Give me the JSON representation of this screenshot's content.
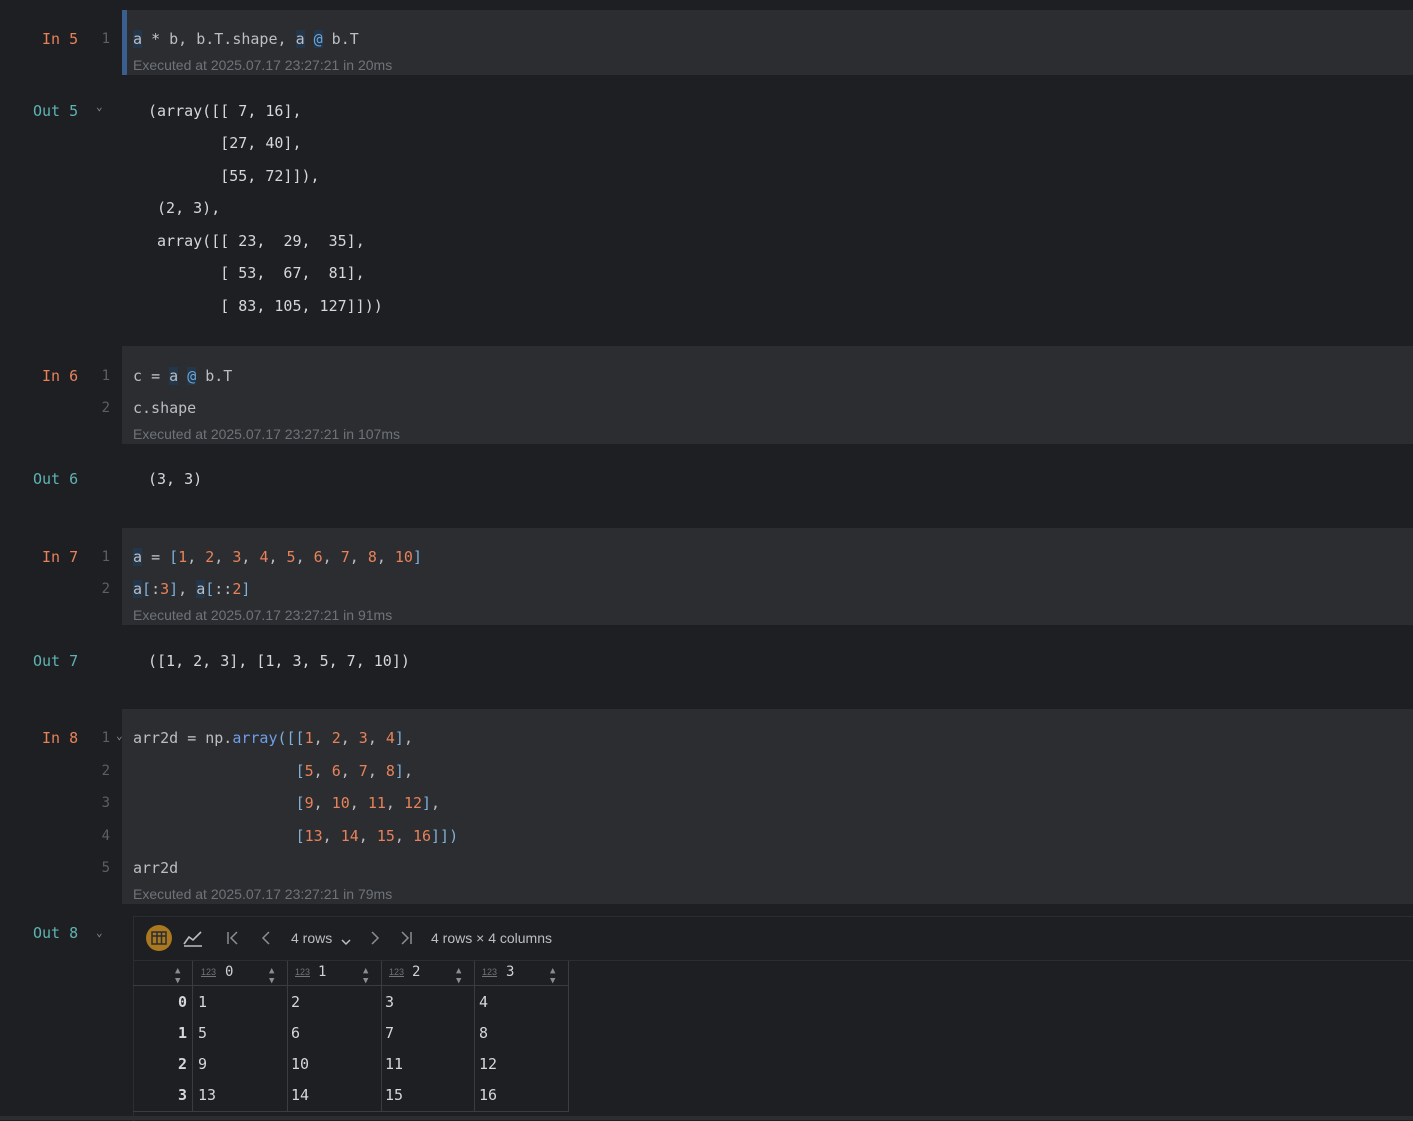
{
  "cells": {
    "in5": {
      "prompt": "In 5",
      "line1": "1",
      "exec": "Executed at 2025.07.17 23:27:21 in 20ms"
    },
    "out5": {
      "prompt": "Out 5",
      "lines": [
        "(array([[ 7, 16],",
        "       [27, 40],",
        "       [55, 72]]),",
        " (2, 3),",
        " array([[ 23,  29,  35],",
        "       [ 53,  67,  81],",
        "       [ 83, 105, 127]]))"
      ]
    },
    "in6": {
      "prompt": "In 6",
      "line1": "1",
      "line2": "2",
      "exec": "Executed at 2025.07.17 23:27:21 in 107ms"
    },
    "out6": {
      "prompt": "Out 6",
      "text": "(3, 3)"
    },
    "in7": {
      "prompt": "In 7",
      "line1": "1",
      "line2": "2",
      "exec": "Executed at 2025.07.17 23:27:21 in 91ms"
    },
    "out7": {
      "prompt": "Out 7",
      "text": "([1, 2, 3], [1, 3, 5, 7, 10])"
    },
    "in8": {
      "prompt": "In 8",
      "lines": [
        "1",
        "2",
        "3",
        "4",
        "5"
      ],
      "exec": "Executed at 2025.07.17 23:27:21 in 79ms"
    },
    "out8": {
      "prompt": "Out 8"
    }
  },
  "dataframe": {
    "rows_selector": "4 rows",
    "summary": "4 rows × 4 columns",
    "type_tag": "123",
    "columns": [
      "0",
      "1",
      "2",
      "3"
    ],
    "index": [
      "0",
      "1",
      "2",
      "3"
    ],
    "rows": [
      [
        "1",
        "2",
        "3",
        "4"
      ],
      [
        "5",
        "6",
        "7",
        "8"
      ],
      [
        "9",
        "10",
        "11",
        "12"
      ],
      [
        "13",
        "14",
        "15",
        "16"
      ]
    ]
  },
  "colors": {
    "background": "#1e1f22",
    "cell": "#2b2d30",
    "number": "#e8825a",
    "prompt_out": "#5fb3b3"
  },
  "icons": [
    "table-view-icon",
    "chart-view-icon",
    "first-page-icon",
    "prev-page-icon",
    "chevron-down-icon",
    "next-page-icon",
    "last-page-icon",
    "sort-icon",
    "fold-chevron-icon"
  ]
}
